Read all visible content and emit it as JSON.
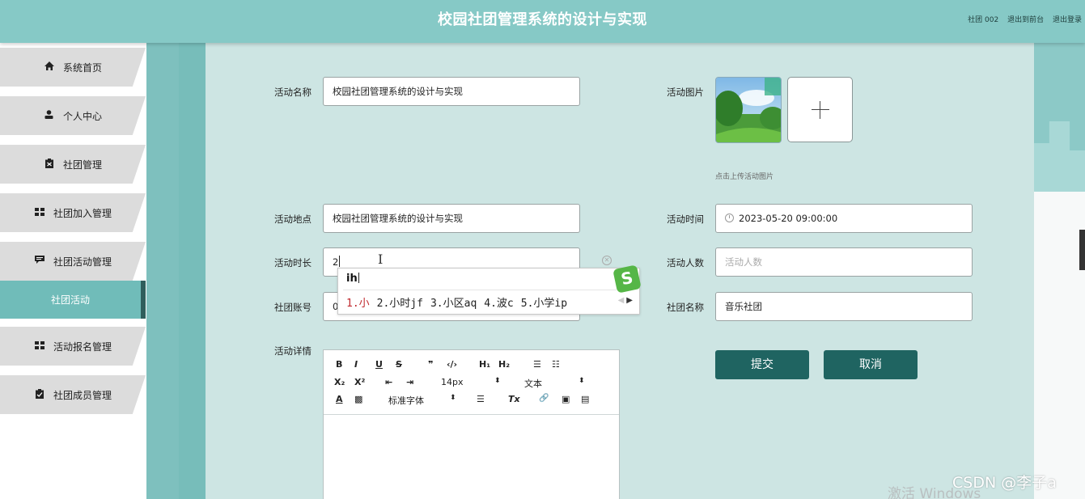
{
  "header": {
    "title": "校园社团管理系统的设计与实现",
    "user": "社团 002",
    "links": [
      "退出到前台",
      "退出登录"
    ]
  },
  "sidebar": {
    "items": [
      {
        "label": "系统首页",
        "icon": "home-icon",
        "glyph": "⌂"
      },
      {
        "label": "个人中心",
        "icon": "user-icon",
        "glyph": "●"
      },
      {
        "label": "社团管理",
        "icon": "clipboard-icon",
        "glyph": "■"
      },
      {
        "label": "社团加入管理",
        "icon": "grid-icon",
        "glyph": "▪▪"
      },
      {
        "label": "社团活动管理",
        "icon": "comment-icon",
        "glyph": "▬"
      },
      {
        "label": "社团活动",
        "icon": "",
        "glyph": ""
      },
      {
        "label": "活动报名管理",
        "icon": "grid-icon",
        "glyph": "▪▪"
      },
      {
        "label": "社团成员管理",
        "icon": "clipboard-check-icon",
        "glyph": "■"
      }
    ]
  },
  "form": {
    "name": {
      "label": "活动名称",
      "value": "校园社团管理系统的设计与实现"
    },
    "image": {
      "label": "活动图片",
      "hint": "点击上传活动图片"
    },
    "place": {
      "label": "活动地点",
      "value": "校园社团管理系统的设计与实现"
    },
    "time": {
      "label": "活动时间",
      "value": "2023-05-20 09:00:00"
    },
    "duration": {
      "label": "活动时长",
      "value": "2"
    },
    "count": {
      "label": "活动人数",
      "placeholder": "活动人数"
    },
    "account": {
      "label": "社团账号",
      "value": "0"
    },
    "club": {
      "label": "社团名称",
      "value": "音乐社团"
    },
    "detail": {
      "label": "活动详情"
    },
    "submit": "提交",
    "cancel": "取消"
  },
  "ime": {
    "composition": "ih",
    "candidates": [
      "1.小",
      "2.小时jf",
      "3.小区aq",
      "4.波c",
      "5.小学ip"
    ],
    "logo": "S"
  },
  "editor": {
    "row1": [
      "B",
      "I",
      "U",
      "S",
      "❞",
      "‹/›",
      "H₁",
      "H₂",
      "☰",
      "☷"
    ],
    "row2": [
      "X₂",
      "X²",
      "⇤",
      "⇥",
      "14px",
      "⬍",
      "文本",
      "⬍"
    ],
    "row3": [
      "A",
      "▩",
      "标准字体",
      "⬍",
      "☰",
      "Tx",
      "🔗",
      "▣",
      "▤"
    ]
  },
  "watermarks": [
    "激活 Windows",
    "CSDN @李子a"
  ]
}
